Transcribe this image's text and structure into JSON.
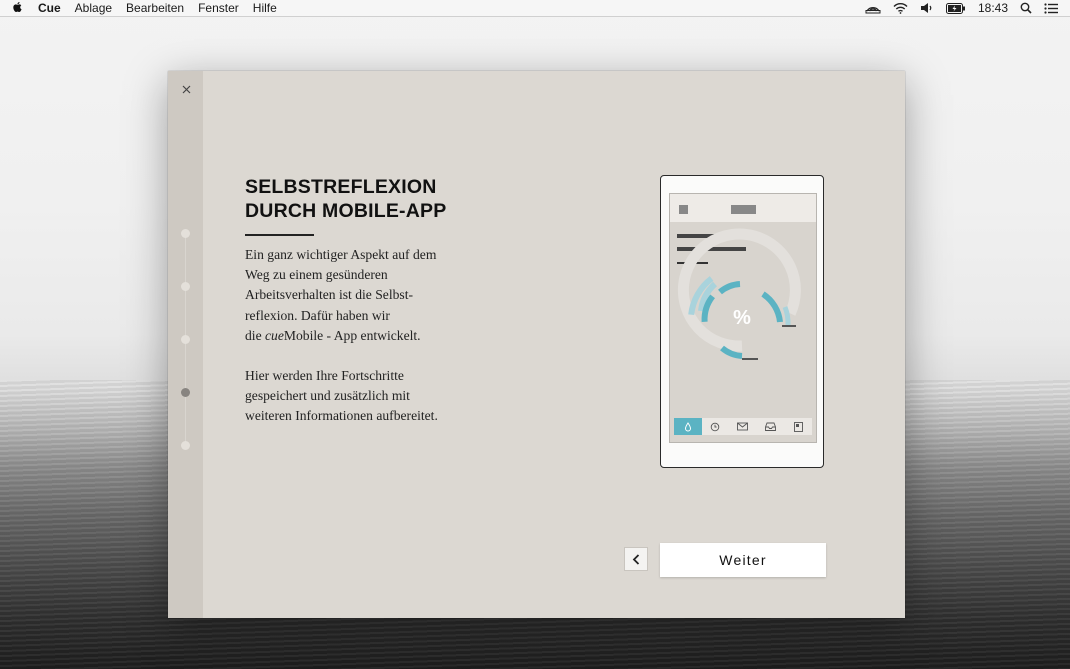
{
  "menubar": {
    "apple_icon": "apple-logo-icon",
    "app_name": "Cue",
    "menus": [
      "Ablage",
      "Bearbeiten",
      "Fenster",
      "Hilfe"
    ],
    "time": "18:43",
    "status_icons": [
      "airplay-icon",
      "wifi-icon",
      "volume-icon",
      "battery-icon",
      "search-icon",
      "list-icon"
    ]
  },
  "dialog": {
    "close_icon": "close-icon",
    "steps_total": 5,
    "active_step": 4,
    "title": "SELBSTREFLEXION\nDURCH MOBILE-APP",
    "paragraph1": {
      "line1": "Ein ganz wichtiger Aspekt auf dem",
      "line2": "Weg zu einem gesünderen",
      "line3": "Arbeitsverhalten ist die Selbst-",
      "line4": "reflexion. Dafür haben wir",
      "line5_pre": "die ",
      "line5_italic": "cue",
      "line5_post": "Mobile - App entwickelt."
    },
    "paragraph2": {
      "line1": "Hier werden Ihre Fortschritte",
      "line2": "gespeichert und zusätzlich mit",
      "line3": "weiteren Informationen aufbereitet."
    },
    "phone": {
      "percent_symbol": "%",
      "tab_icons": [
        "drop-icon",
        "clock-icon",
        "mail-icon",
        "inbox-icon",
        "document-icon"
      ],
      "active_tab": 0,
      "accent_color": "#5bb3c3",
      "accent_light_color": "#a9d3dc"
    },
    "back_icon": "chevron-left-icon",
    "next_label": "Weiter"
  }
}
